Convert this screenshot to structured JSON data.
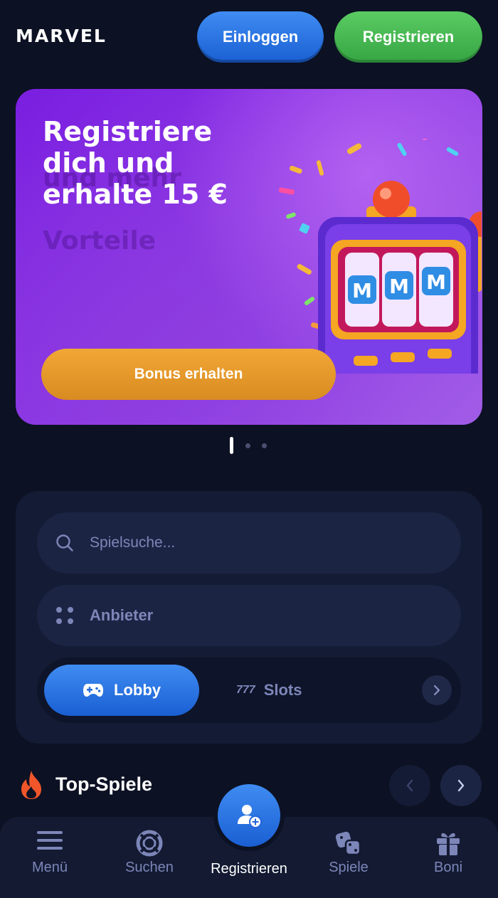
{
  "header": {
    "logo": "MARVEL",
    "login_label": "Einloggen",
    "register_label": "Registrieren"
  },
  "banner": {
    "title": "Registriere dich und erhalte 15 €",
    "ghost_text": "und mehr Vorteile",
    "cta_label": "Bonus erhalten",
    "slot_symbol": "M",
    "slides_total": 3,
    "active_slide": 1
  },
  "search": {
    "placeholder": "Spielsuche...",
    "providers_label": "Anbieter"
  },
  "tabs": [
    {
      "label": "Lobby",
      "icon": "gamepad-icon",
      "active": true
    },
    {
      "label": "Slots",
      "icon": "slots-777-icon",
      "active": false
    }
  ],
  "top_games": {
    "title": "Top-Spiele",
    "icon": "fire-icon"
  },
  "bottom_nav": {
    "items": [
      {
        "label": "Menü",
        "icon": "menu-icon"
      },
      {
        "label": "Suchen",
        "icon": "lifebuoy-icon"
      },
      {
        "label": "Registrieren",
        "icon": "add-user-icon"
      },
      {
        "label": "Spiele",
        "icon": "dice-icon"
      },
      {
        "label": "Boni",
        "icon": "gift-icon"
      }
    ]
  },
  "colors": {
    "background": "#0c1123",
    "panel": "#141b34",
    "accent_blue": "#2f7ae8",
    "accent_green": "#46b852",
    "accent_orange": "#e6982b",
    "muted_text": "#7d86b8"
  }
}
